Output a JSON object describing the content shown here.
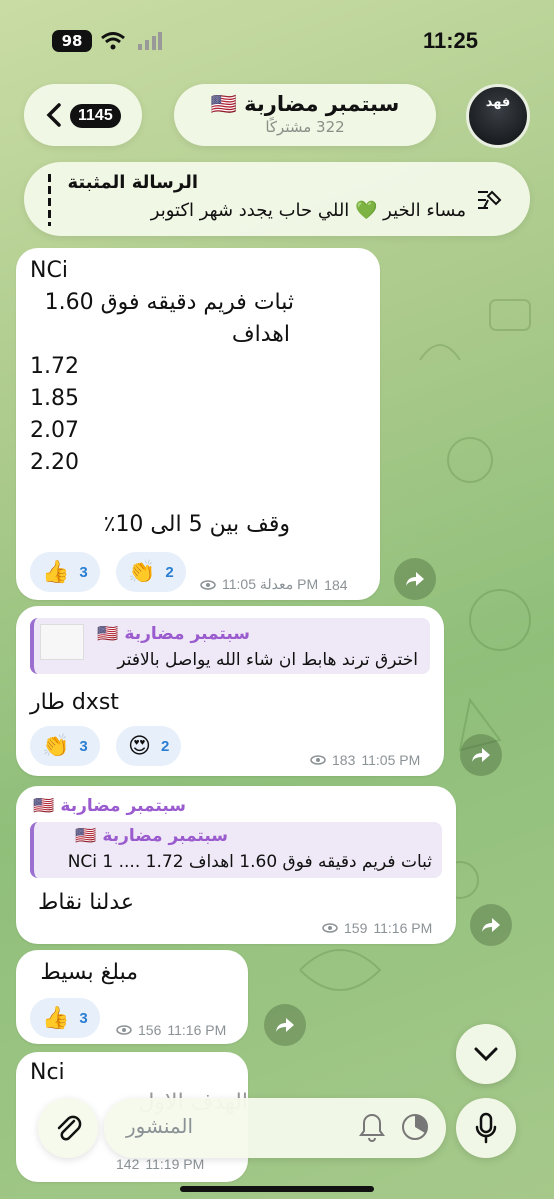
{
  "status": {
    "battery": "98",
    "time": "11:25"
  },
  "header": {
    "back_count": "1145",
    "title": "سبتمبر مضاربة 🇺🇸",
    "subtitle": "322 مشتركًا",
    "avatar_text": "فهد"
  },
  "pinned": {
    "title": "الرسالة المثبتة",
    "text": "مساء الخير 💚 اللي حاب يجدد شهر اكتوبر"
  },
  "messages": [
    {
      "lines": [
        "NCi",
        "ثبات فريم دقيقه فوق 1.60",
        "اهداف",
        "1.72",
        "1.85",
        "2.07",
        "2.20",
        "وقف بين 5 الى 10٪"
      ],
      "reactions": [
        {
          "emoji": "👍",
          "count": "3"
        },
        {
          "emoji": "👏",
          "count": "2"
        }
      ],
      "views": "184",
      "meta": "معدلة 11:05 PM"
    },
    {
      "quote_name": "سبتمبر مضاربة 🇺🇸",
      "quote_text": "اخترق ترند هابط ان شاء الله يواصل بالافتر",
      "text": "طار dxst",
      "reactions": [
        {
          "emoji": "👏",
          "count": "3"
        },
        {
          "emoji": "😍",
          "count": "2"
        }
      ],
      "views": "183",
      "meta": "11:05 PM"
    },
    {
      "sender": "سبتمبر مضاربة 🇺🇸",
      "quote_name": "سبتمبر مضاربة 🇺🇸",
      "quote_text": "ثبات فريم دقيقه فوق 1.60 اهداف 1.72 .... NCi 1",
      "text": "عدلنا نقاط",
      "views": "159",
      "meta": "11:16 PM"
    },
    {
      "text": "مبلغ بسيط",
      "reactions": [
        {
          "emoji": "👍",
          "count": "3"
        }
      ],
      "views": "156",
      "meta": "11:16 PM"
    },
    {
      "text": "Nci",
      "sub": "الهدف الاول",
      "views": "142",
      "meta": "11:19 PM"
    }
  ],
  "composer": {
    "placeholder": "المنشور"
  }
}
